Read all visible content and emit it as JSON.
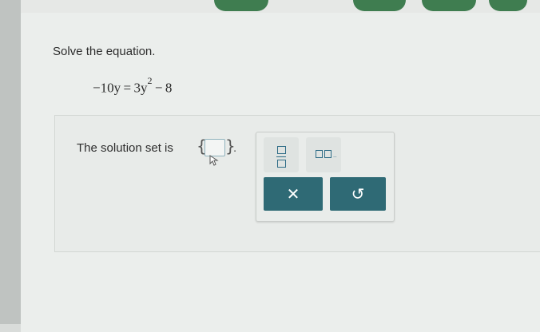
{
  "problem": {
    "instruction": "Solve the equation.",
    "equation_lhs": "−10y = 3y",
    "equation_exponent": "2",
    "equation_rhs": " − 8"
  },
  "answer": {
    "label": "The solution set is",
    "open_brace": "{",
    "close_brace": "}",
    "period": ".",
    "value": ""
  },
  "palette": {
    "clear_symbol": "✕",
    "undo_symbol": "↺",
    "tools": [
      "fraction-icon",
      "mixed-number-icon"
    ]
  },
  "colors": {
    "action_button": "#2f6a75",
    "tab_green": "#3f7d50",
    "input_border": "#8fb2bd"
  }
}
